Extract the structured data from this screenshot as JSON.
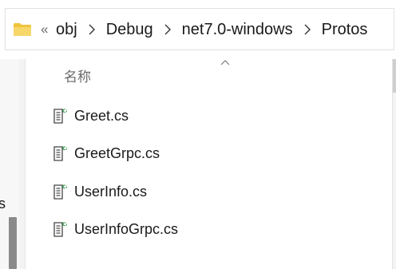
{
  "address_bar": {
    "overflow_glyph": "«",
    "crumbs": [
      "obj",
      "Debug",
      "net7.0-windows",
      "Protos"
    ],
    "folder_icon": "folder-icon",
    "separator_icon": "chevron-right-icon"
  },
  "file_list": {
    "column_header": "名称",
    "sort_icon": "sort-ascending-icon",
    "files": [
      {
        "name": "Greet.cs",
        "icon": "csharp-file-icon"
      },
      {
        "name": "GreetGrpc.cs",
        "icon": "csharp-file-icon"
      },
      {
        "name": "UserInfo.cs",
        "icon": "csharp-file-icon"
      },
      {
        "name": "UserInfoGrpc.cs",
        "icon": "csharp-file-icon"
      }
    ]
  },
  "nav_pane": {
    "cut_text": "s"
  },
  "colors": {
    "folder": "#f0c33c",
    "icon_green": "#1f8f3a",
    "header_text": "#6b6b6b"
  }
}
